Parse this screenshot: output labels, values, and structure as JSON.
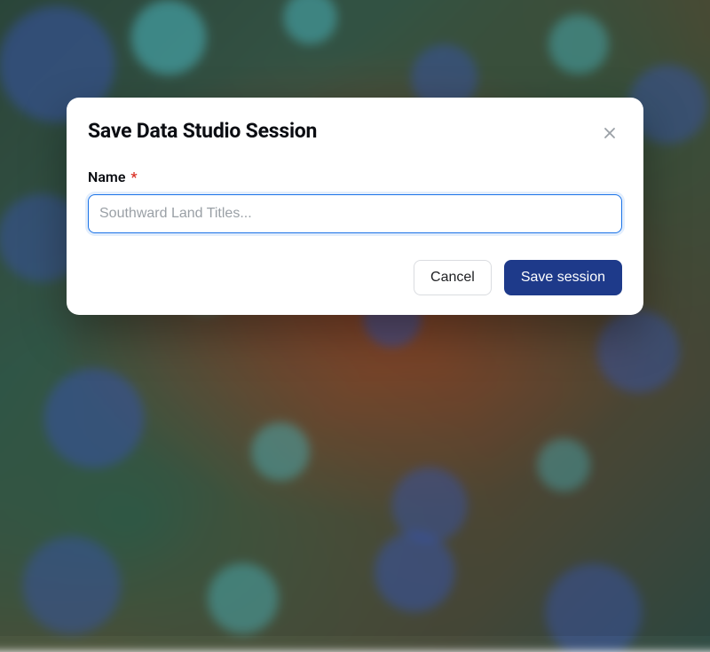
{
  "modal": {
    "title": "Save Data Studio Session",
    "name_label": "Name",
    "required_mark": "*",
    "name_value": "",
    "name_placeholder": "Southward Land Titles...",
    "cancel_label": "Cancel",
    "save_label": "Save session"
  },
  "colors": {
    "primary": "#1e3a8a",
    "focus_ring": "#1a73e8",
    "danger": "#d93025"
  }
}
